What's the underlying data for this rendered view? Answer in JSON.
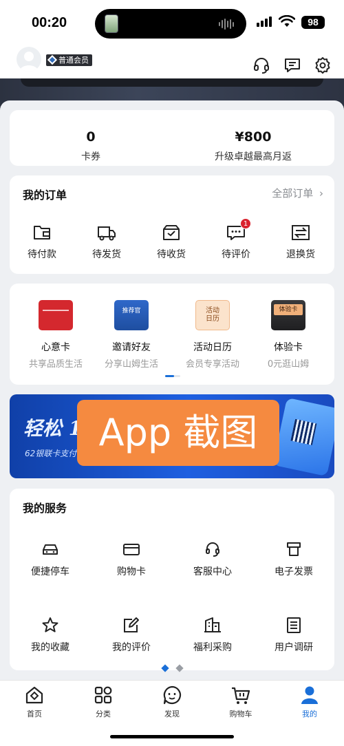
{
  "status_bar": {
    "time": "00:20",
    "battery": "98"
  },
  "header": {
    "member_badge": "普通会员"
  },
  "stats": [
    {
      "value": "0",
      "label": "卡券"
    },
    {
      "value": "¥800",
      "label": "升级卓越最高月返"
    }
  ],
  "orders": {
    "title": "我的订单",
    "all_link": "全部订单",
    "items": [
      {
        "label": "待付款",
        "icon": "wallet-icon"
      },
      {
        "label": "待发货",
        "icon": "truck-icon"
      },
      {
        "label": "待收货",
        "icon": "box-icon"
      },
      {
        "label": "待评价",
        "icon": "comment-icon",
        "badge": "1"
      },
      {
        "label": "退换货",
        "icon": "exchange-icon"
      }
    ]
  },
  "perks": {
    "items": [
      {
        "name": "心意卡",
        "sub": "共享品质生活",
        "color": "#d4282e"
      },
      {
        "name": "邀请好友",
        "sub": "分享山姆生活",
        "img_text": "推荐官",
        "color": "#2f68c9"
      },
      {
        "name": "活动日历",
        "sub": "会员专享活动",
        "img_text": "活动\n日历",
        "color": "#f3b98a"
      },
      {
        "name": "体验卡",
        "sub": "0元逛山姆",
        "img_text": "体验卡",
        "color": "#3a3a3c"
      }
    ]
  },
  "promo": {
    "headline": "轻松 1",
    "sub": "62银联卡支付",
    "watermark": "App 截图"
  },
  "services": {
    "title": "我的服务",
    "items": [
      {
        "label": "便捷停车",
        "icon": "car-icon"
      },
      {
        "label": "购物卡",
        "icon": "card-icon"
      },
      {
        "label": "客服中心",
        "icon": "headset-icon"
      },
      {
        "label": "电子发票",
        "icon": "receipt-icon"
      },
      {
        "label": "我的收藏",
        "icon": "star-icon"
      },
      {
        "label": "我的评价",
        "icon": "edit-icon"
      },
      {
        "label": "福利采购",
        "icon": "building-icon"
      },
      {
        "label": "用户调研",
        "icon": "survey-icon"
      }
    ]
  },
  "tabs": [
    {
      "label": "首页",
      "icon": "home-icon"
    },
    {
      "label": "分类",
      "icon": "category-icon"
    },
    {
      "label": "发现",
      "icon": "discover-icon"
    },
    {
      "label": "购物车",
      "icon": "cart-icon"
    },
    {
      "label": "我的",
      "icon": "profile-icon",
      "active": true
    }
  ],
  "colors": {
    "accent": "#1a6fd8",
    "badge_red": "#d9232e",
    "watermark": "#f58a40"
  }
}
